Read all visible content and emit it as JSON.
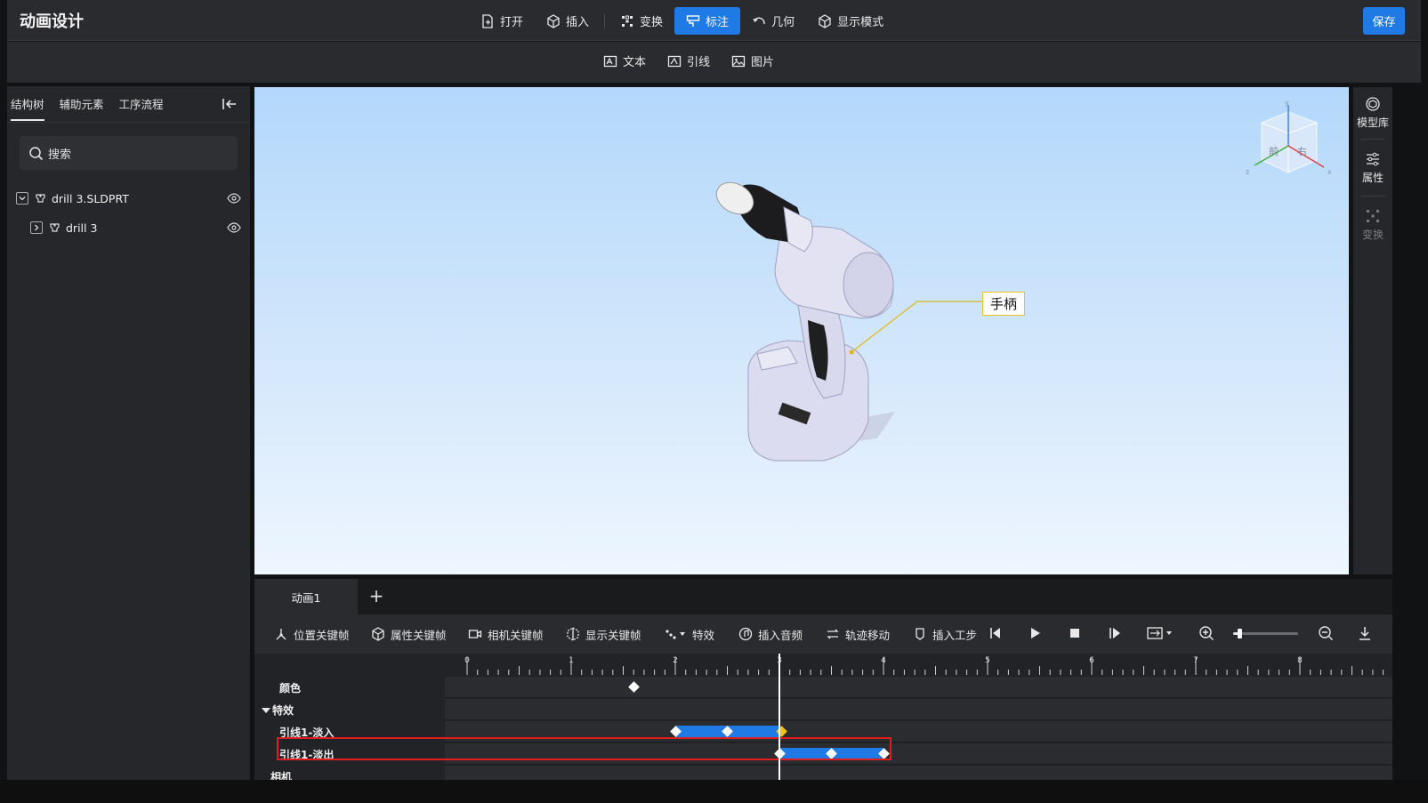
{
  "app": {
    "title": "动画设计",
    "save_label": "保存"
  },
  "main_toolbar": [
    {
      "label": "打开",
      "icon": "file-open-icon"
    },
    {
      "label": "插入",
      "icon": "cube-icon"
    },
    {
      "label": "变换",
      "icon": "transform-icon"
    },
    {
      "label": "标注",
      "icon": "annotate-icon",
      "active": true
    },
    {
      "label": "几何",
      "icon": "arc-icon"
    },
    {
      "label": "显示模式",
      "icon": "display-mode-icon"
    }
  ],
  "sub_toolbar": [
    {
      "label": "文本",
      "icon": "text-icon"
    },
    {
      "label": "引线",
      "icon": "leader-icon"
    },
    {
      "label": "图片",
      "icon": "image-icon"
    }
  ],
  "left_panel": {
    "tabs": [
      "结构树",
      "辅助元素",
      "工序流程"
    ],
    "active_tab": "结构树",
    "search_placeholder": "搜索",
    "tree": [
      {
        "label": "drill 3.SLDPRT",
        "expanded": true,
        "level": 0
      },
      {
        "label": "drill 3",
        "expanded": false,
        "level": 1
      }
    ]
  },
  "viewport": {
    "callout_text": "手柄",
    "axis_labels": {
      "x": "x",
      "y": "y",
      "z": "z"
    },
    "cube_faces": {
      "front": "前",
      "right": "右"
    }
  },
  "right_bar": [
    {
      "label": "模型库",
      "icon": "model-library-icon",
      "enabled": true
    },
    {
      "label": "属性",
      "icon": "properties-icon",
      "enabled": true
    },
    {
      "label": "变换",
      "icon": "transform-icon",
      "enabled": false
    }
  ],
  "bottom_panel": {
    "tabs": [
      "动画1"
    ],
    "add_tab_label": "+",
    "timeline_toolbar": [
      {
        "label": "位置关键帧",
        "icon": "position-keyframe-icon"
      },
      {
        "label": "属性关键帧",
        "icon": "property-keyframe-icon"
      },
      {
        "label": "相机关键帧",
        "icon": "camera-keyframe-icon"
      },
      {
        "label": "显示关键帧",
        "icon": "display-keyframe-icon"
      },
      {
        "label": "特效",
        "icon": "effects-icon"
      },
      {
        "label": "插入音频",
        "icon": "audio-icon"
      },
      {
        "label": "轨迹移动",
        "icon": "trajectory-icon"
      },
      {
        "label": "插入工步",
        "icon": "step-icon"
      }
    ],
    "zoom_level": 0.1,
    "ruler_ticks": [
      "0",
      "1",
      "2",
      "3",
      "4",
      "5",
      "6",
      "7",
      "8"
    ],
    "playhead_time": 3.0,
    "tracks": [
      {
        "label": "颜色",
        "keyframes": [
          1.6
        ]
      },
      {
        "label": "特效",
        "group": true
      },
      {
        "label": "引线1-淡入",
        "clip": [
          2.0,
          3.0
        ],
        "keyframes": [
          2.0,
          2.5
        ],
        "yellow_keyframes": [
          3.0
        ]
      },
      {
        "label": "引线1-淡出",
        "clip": [
          3.0,
          4.0
        ],
        "keyframes": [
          3.0,
          3.5,
          4.0
        ],
        "highlighted": true
      },
      {
        "label": "相机"
      }
    ]
  },
  "colors": {
    "accent": "#1f7ae6",
    "callout_border": "#f0c21c",
    "highlight": "#e01e1e"
  }
}
